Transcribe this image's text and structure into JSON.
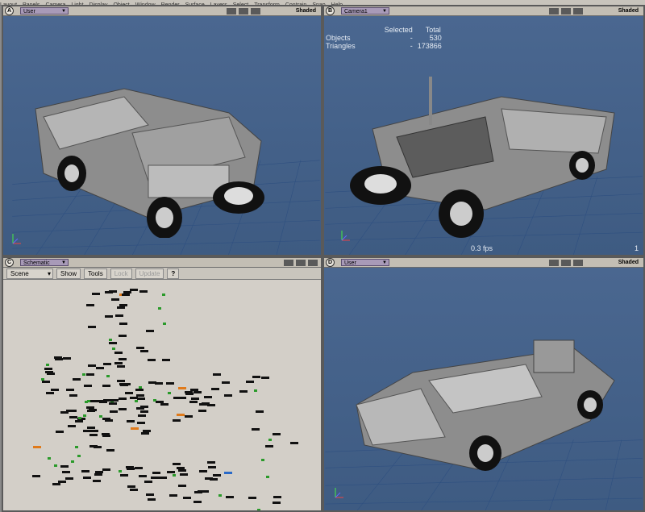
{
  "menubar": {
    "items": [
      "Layout",
      "Panels",
      "Camera",
      "Light",
      "Display",
      "Object",
      "Window",
      "Render",
      "Surface",
      "Layers",
      "Select",
      "Transform",
      "Contrain",
      "Snap",
      "Help"
    ]
  },
  "panes": {
    "a": {
      "letter": "A",
      "camera": "User",
      "mode": "Shaded"
    },
    "b": {
      "letter": "B",
      "camera": "Camera1",
      "mode": "Shaded",
      "stats": {
        "col_selected": "Selected",
        "col_total": "Total",
        "objects_label": "Objects",
        "objects_selected": "-",
        "objects_total": "530",
        "triangles_label": "Triangles",
        "triangles_selected": "-",
        "triangles_total": "173866"
      },
      "fps": "0.3 fps",
      "fps_right": "1"
    },
    "c": {
      "letter": "C",
      "camera": "Schematic",
      "toolbar": {
        "scene": "Scene",
        "show": "Show",
        "tools": "Tools",
        "lock": "Lock",
        "update": "Update",
        "help": "?"
      }
    },
    "d": {
      "letter": "D",
      "camera": "User",
      "mode": "Shaded"
    }
  },
  "colors": {
    "viewport_bg": "#4a6790",
    "header_bg": "#c3beb4",
    "tab": "#a89ab8",
    "schematic_bg": "#d3cfc8"
  }
}
